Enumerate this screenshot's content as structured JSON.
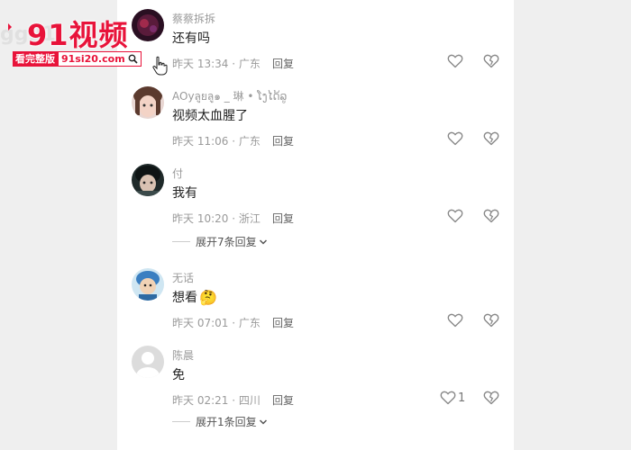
{
  "watermark": {
    "title": "91视频",
    "ghost": "gg91",
    "tag_left": "看完整版",
    "tag_right": "91si20.com"
  },
  "comments": [
    {
      "user": "蔡蔡拆拆",
      "text": "还有吗",
      "time": "昨天 13:34 · 广东",
      "reply": "回复",
      "likes": "",
      "avatar": "dark-red-avatar"
    },
    {
      "user": "AOyลูยลู๑ _ 琳 • ໂງໄດ້ລູ",
      "text": "视频太血腥了",
      "time": "昨天 11:06 · 广东",
      "reply": "回复",
      "likes": "",
      "avatar": "girl-avatar"
    },
    {
      "user": "付",
      "text": "我有",
      "time": "昨天 10:20 · 浙江",
      "reply": "回复",
      "likes": "",
      "avatar": "anime-avatar",
      "expand": "展开7条回复"
    },
    {
      "user": "无话",
      "text": "想看",
      "emoji": "🤔",
      "time": "昨天 07:01 · 广东",
      "reply": "回复",
      "likes": "",
      "avatar": "cartoon-avatar"
    },
    {
      "user": "陈晨",
      "text": "免",
      "time": "昨天 02:21 · 四川",
      "reply": "回复",
      "likes": "1",
      "avatar": "default-avatar",
      "expand": "展开1条回复"
    }
  ]
}
